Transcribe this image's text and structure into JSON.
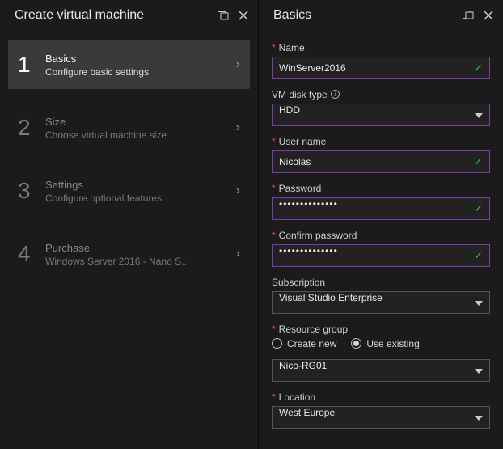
{
  "left": {
    "title": "Create virtual machine",
    "steps": [
      {
        "num": "1",
        "title": "Basics",
        "sub": "Configure basic settings",
        "active": true
      },
      {
        "num": "2",
        "title": "Size",
        "sub": "Choose virtual machine size",
        "active": false
      },
      {
        "num": "3",
        "title": "Settings",
        "sub": "Configure optional features",
        "active": false
      },
      {
        "num": "4",
        "title": "Purchase",
        "sub": "Windows Server 2016 - Nano S...",
        "active": false
      }
    ]
  },
  "right": {
    "title": "Basics",
    "name": {
      "label": "Name",
      "value": "WinServer2016",
      "required": true,
      "valid": true
    },
    "disk": {
      "label": "VM disk type",
      "value": "HDD",
      "required": false,
      "info": true
    },
    "user": {
      "label": "User name",
      "value": "Nicolas",
      "required": true,
      "valid": true
    },
    "password": {
      "label": "Password",
      "value": "••••••••••••••",
      "required": true,
      "valid": true
    },
    "confirm": {
      "label": "Confirm password",
      "value": "••••••••••••••",
      "required": true,
      "valid": true
    },
    "subscription": {
      "label": "Subscription",
      "value": "Visual Studio Enterprise",
      "required": false
    },
    "rg": {
      "label": "Resource group",
      "required": true,
      "options": [
        "Create new",
        "Use existing"
      ],
      "selected": "Use existing",
      "value": "Nico-RG01"
    },
    "location": {
      "label": "Location",
      "value": "West Europe",
      "required": true
    }
  }
}
